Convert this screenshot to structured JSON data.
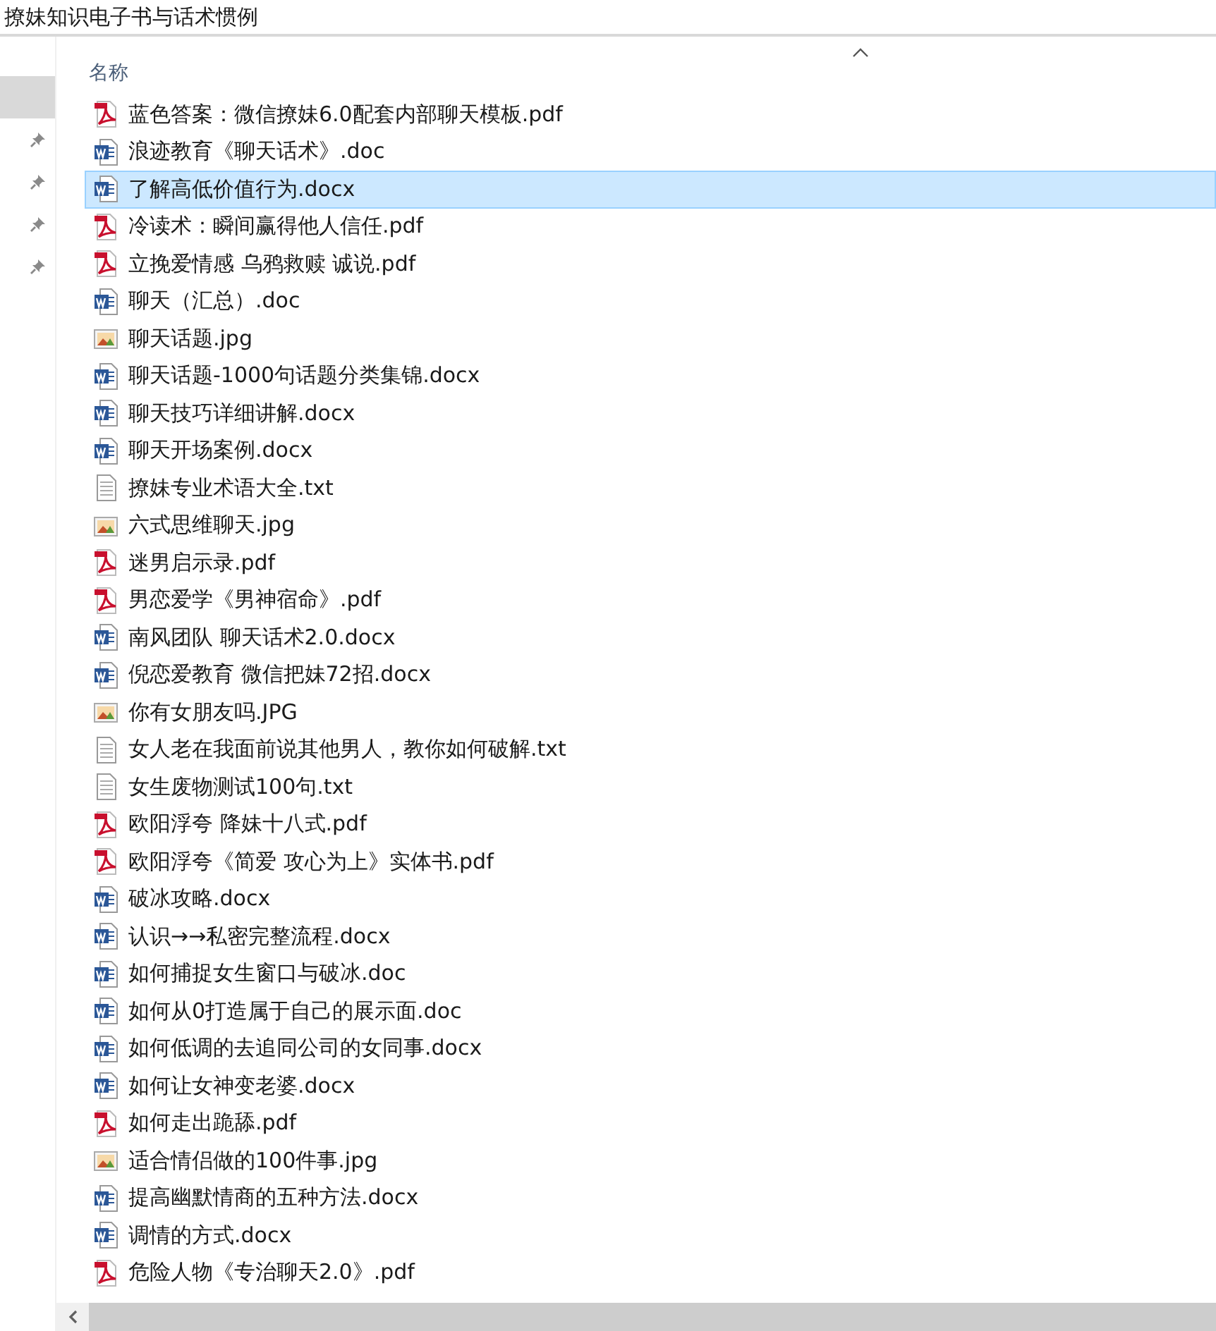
{
  "window": {
    "title": "撩妹知识电子书与话术惯例"
  },
  "sidebar": {
    "items": [
      {
        "selected": true,
        "pinned": false
      },
      {
        "selected": false,
        "pinned": true
      },
      {
        "selected": false,
        "pinned": true
      },
      {
        "selected": false,
        "pinned": true
      },
      {
        "selected": false,
        "pinned": true
      }
    ]
  },
  "table": {
    "columns": [
      {
        "label": "名称",
        "sort_ascending": true
      }
    ],
    "rows": [
      {
        "name": "蓝色答案：微信撩妹6.0配套内部聊天模板.pdf",
        "kind": "pdf",
        "selected": false
      },
      {
        "name": "浪迹教育《聊天话术》.doc",
        "kind": "word",
        "selected": false
      },
      {
        "name": "了解高低价值行为.docx",
        "kind": "word",
        "selected": true
      },
      {
        "name": "冷读术：瞬间赢得他人信任.pdf",
        "kind": "pdf",
        "selected": false
      },
      {
        "name": "立挽爱情感 乌鸦救赎 诚说.pdf",
        "kind": "pdf",
        "selected": false
      },
      {
        "name": "聊天（汇总）.doc",
        "kind": "word",
        "selected": false
      },
      {
        "name": "聊天话题.jpg",
        "kind": "image",
        "selected": false
      },
      {
        "name": "聊天话题-1000句话题分类集锦.docx",
        "kind": "word",
        "selected": false
      },
      {
        "name": "聊天技巧详细讲解.docx",
        "kind": "word",
        "selected": false
      },
      {
        "name": "聊天开场案例.docx",
        "kind": "word",
        "selected": false
      },
      {
        "name": "撩妹专业术语大全.txt",
        "kind": "text",
        "selected": false
      },
      {
        "name": "六式思维聊天.jpg",
        "kind": "image",
        "selected": false
      },
      {
        "name": "迷男启示录.pdf",
        "kind": "pdf",
        "selected": false
      },
      {
        "name": "男恋爱学《男神宿命》.pdf",
        "kind": "pdf",
        "selected": false
      },
      {
        "name": "南风团队 聊天话术2.0.docx",
        "kind": "word",
        "selected": false
      },
      {
        "name": "倪恋爱教育 微信把妹72招.docx",
        "kind": "word",
        "selected": false
      },
      {
        "name": "你有女朋友吗.JPG",
        "kind": "image",
        "selected": false
      },
      {
        "name": "女人老在我面前说其他男人，教你如何破解.txt",
        "kind": "text",
        "selected": false
      },
      {
        "name": "女生废物测试100句.txt",
        "kind": "text",
        "selected": false
      },
      {
        "name": "欧阳浮夸 降妹十八式.pdf",
        "kind": "pdf",
        "selected": false
      },
      {
        "name": "欧阳浮夸《简爱 攻心为上》实体书.pdf",
        "kind": "pdf",
        "selected": false
      },
      {
        "name": "破冰攻略.docx",
        "kind": "word",
        "selected": false
      },
      {
        "name": "认识→→私密完整流程.docx",
        "kind": "word",
        "selected": false
      },
      {
        "name": "如何捕捉女生窗口与破冰.doc",
        "kind": "word",
        "selected": false
      },
      {
        "name": "如何从0打造属于自己的展示面.doc",
        "kind": "word",
        "selected": false
      },
      {
        "name": "如何低调的去追同公司的女同事.docx",
        "kind": "word",
        "selected": false
      },
      {
        "name": "如何让女神变老婆.docx",
        "kind": "word",
        "selected": false
      },
      {
        "name": "如何走出跪舔.pdf",
        "kind": "pdf",
        "selected": false
      },
      {
        "name": "适合情侣做的100件事.jpg",
        "kind": "image",
        "selected": false
      },
      {
        "name": "提高幽默情商的五种方法.docx",
        "kind": "word",
        "selected": false
      },
      {
        "name": "调情的方式.docx",
        "kind": "word",
        "selected": false
      },
      {
        "name": "危险人物《专治聊天2.0》.pdf",
        "kind": "pdf",
        "selected": false
      }
    ]
  }
}
